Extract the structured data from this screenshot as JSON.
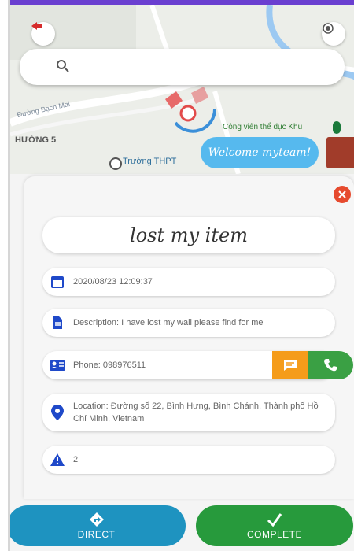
{
  "map": {
    "labels": {
      "road": "Đường Bạch Mai",
      "district": "HƯỜNG 5",
      "school": "Trường THPT",
      "park": "Công viên thể dục Khu"
    },
    "search": {
      "placeholder": ""
    },
    "welcome": "Welcome myteam!"
  },
  "panel": {
    "title": "lost my item",
    "datetime": "2020/08/23 12:09:37",
    "description": "Description: I have lost my wall please find for me",
    "phone": "Phone: 098976511",
    "location": "Location: Đường số 22, Bình Hưng, Bình Chánh, Thành phố Hồ Chí Minh, Vietnam",
    "count": "2"
  },
  "actions": {
    "direct": "DIRECT",
    "complete": "COMPLETE"
  },
  "colors": {
    "topbar": "#6a3fd0",
    "close": "#e64a2e",
    "icon_blue": "#1f49c9",
    "message": "#f59c1a",
    "call": "#3aa044",
    "direct": "#1e93c0",
    "complete": "#279a3c",
    "welcome": "#56b9ee"
  }
}
